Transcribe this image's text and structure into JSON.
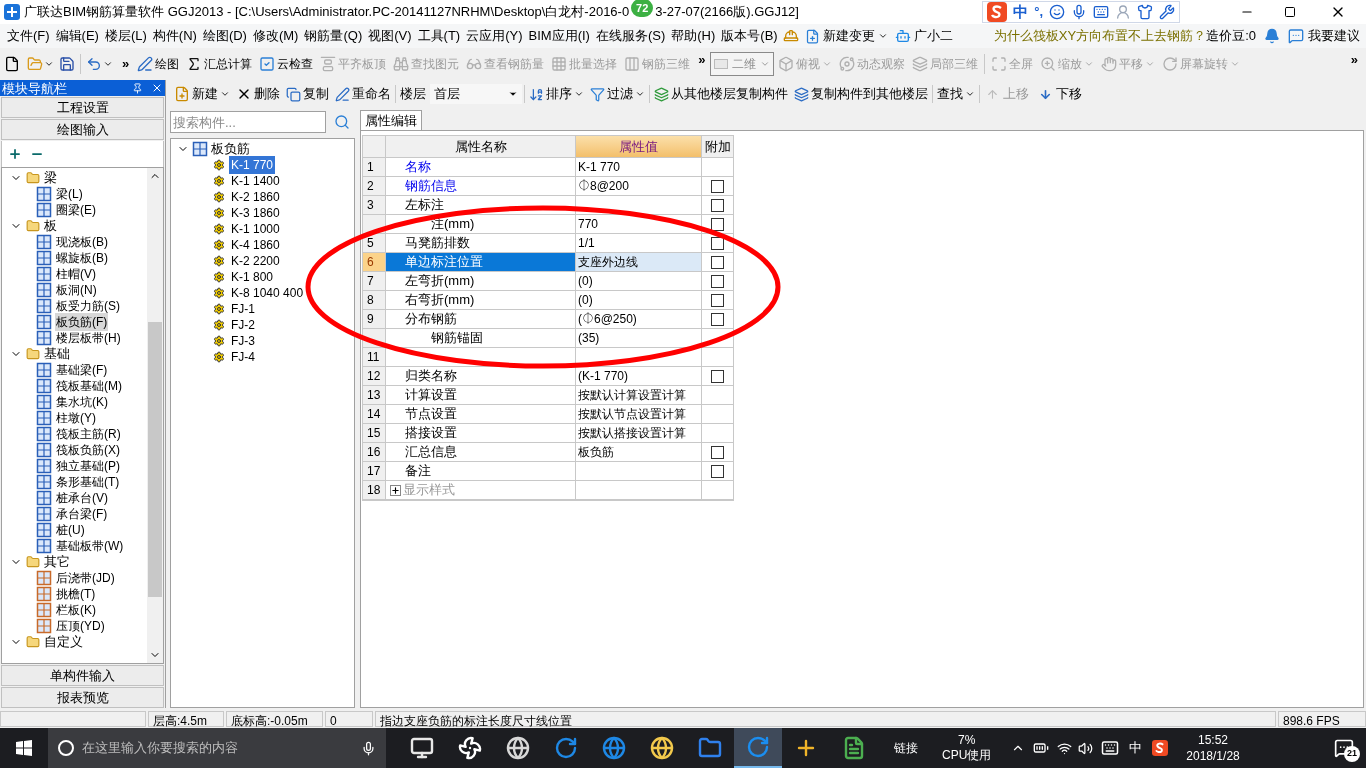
{
  "title_bar": {
    "title": "广联达BIM钢筋算量软件 GGJ2013 - [C:\\Users\\Administrator.PC-20141127NRHM\\Desktop\\白龙村-2016-0",
    "badge": "72",
    "title_end": "3-27-07(2166版).GGJ12]",
    "ime": [
      "中",
      "°,"
    ]
  },
  "menu": {
    "items": [
      "文件(F)",
      "编辑(E)",
      "楼层(L)",
      "构件(N)",
      "绘图(D)",
      "修改(M)",
      "钢筋量(Q)",
      "视图(V)",
      "工具(T)",
      "云应用(Y)",
      "BIM应用(I)",
      "在线服务(S)",
      "帮助(H)",
      "版本号(B)"
    ],
    "extras": [
      {
        "label": "新建变更",
        "menu": true
      },
      {
        "label": "广小二",
        "menu": false
      }
    ],
    "question": "为什么筏板XY方向布置不上去钢筋？",
    "beans": "造价豆:0",
    "suggest": "我要建议"
  },
  "toolbar": {
    "more": "»",
    "groups": [
      [
        {
          "label": "绘图",
          "disabled": false,
          "menu": false
        },
        {
          "label": "汇总计算",
          "disabled": false,
          "menu": false
        },
        {
          "label": "云检查",
          "disabled": false,
          "menu": false
        },
        {
          "label": "平齐板顶",
          "disabled": true,
          "menu": false
        },
        {
          "label": "查找图元",
          "disabled": true,
          "menu": false
        },
        {
          "label": "查看钢筋量",
          "disabled": true,
          "menu": false
        },
        {
          "label": "批量选择",
          "disabled": true,
          "menu": false
        },
        {
          "label": "钢筋三维",
          "disabled": true,
          "menu": false
        }
      ],
      [
        {
          "label": "俯视",
          "disabled": true,
          "menu": true
        },
        {
          "label": "动态观察",
          "disabled": true,
          "menu": false
        },
        {
          "label": "局部三维",
          "disabled": true,
          "menu": false
        }
      ],
      [
        {
          "label": "全屏",
          "disabled": true,
          "menu": false
        },
        {
          "label": "缩放",
          "disabled": true,
          "menu": true
        },
        {
          "label": "平移",
          "disabled": true,
          "menu": true
        },
        {
          "label": "屏幕旋转",
          "disabled": true,
          "menu": true
        }
      ]
    ],
    "view_select": "二维",
    "more_end": "»"
  },
  "nav": {
    "title": "模块导航栏",
    "top_buttons": [
      "工程设置",
      "绘图输入"
    ],
    "groups": [
      {
        "label": "梁",
        "expanded": true,
        "children": [
          {
            "label": "梁(L)",
            "selected": false
          },
          {
            "label": "圈梁(E)",
            "selected": false
          }
        ]
      },
      {
        "label": "板",
        "expanded": true,
        "children": [
          {
            "label": "现浇板(B)",
            "selected": false
          },
          {
            "label": "螺旋板(B)",
            "selected": false
          },
          {
            "label": "柱帽(V)",
            "selected": false
          },
          {
            "label": "板洞(N)",
            "selected": false
          },
          {
            "label": "板受力筋(S)",
            "selected": false
          },
          {
            "label": "板负筋(F)",
            "selected": true
          },
          {
            "label": "楼层板带(H)",
            "selected": false
          }
        ]
      },
      {
        "label": "基础",
        "expanded": true,
        "children": [
          {
            "label": "基础梁(F)",
            "selected": false
          },
          {
            "label": "筏板基础(M)",
            "selected": false
          },
          {
            "label": "集水坑(K)",
            "selected": false
          },
          {
            "label": "柱墩(Y)",
            "selected": false
          },
          {
            "label": "筏板主筋(R)",
            "selected": false
          },
          {
            "label": "筏板负筋(X)",
            "selected": false
          },
          {
            "label": "独立基础(P)",
            "selected": false
          },
          {
            "label": "条形基础(T)",
            "selected": false
          },
          {
            "label": "桩承台(V)",
            "selected": false
          },
          {
            "label": "承台梁(F)",
            "selected": false
          },
          {
            "label": "桩(U)",
            "selected": false
          },
          {
            "label": "基础板带(W)",
            "selected": false
          }
        ]
      },
      {
        "label": "其它",
        "expanded": true,
        "children": [
          {
            "label": "后浇带(JD)",
            "selected": false
          },
          {
            "label": "挑檐(T)",
            "selected": false
          },
          {
            "label": "栏板(K)",
            "selected": false
          },
          {
            "label": "压顶(YD)",
            "selected": false
          }
        ]
      },
      {
        "label": "自定义",
        "expanded": true
      }
    ],
    "bottom_buttons": [
      "单构件输入",
      "报表预览"
    ]
  },
  "component_toolbar": {
    "new": "新建",
    "delete": "删除",
    "copy": "复制",
    "rename": "重命名",
    "floor_label": "楼层",
    "floor": "首层",
    "sort": "排序",
    "filter": "过滤",
    "copy_from": "从其他楼层复制构件",
    "copy_to": "复制构件到其他楼层",
    "find": "查找",
    "up": {
      "label": "上移",
      "disabled": true
    },
    "down": {
      "label": "下移",
      "disabled": false
    }
  },
  "component_tree": {
    "placeholder": "搜索构件...",
    "root": {
      "label": "板负筋",
      "expanded": true,
      "children": [
        {
          "label": "K-1 770",
          "selected": true
        },
        {
          "label": "K-1 1400",
          "selected": false
        },
        {
          "label": "K-2 1860",
          "selected": false
        },
        {
          "label": "K-3 1860",
          "selected": false
        },
        {
          "label": "K-1 1000",
          "selected": false
        },
        {
          "label": "K-4 1860",
          "selected": false
        },
        {
          "label": "K-2 2200",
          "selected": false
        },
        {
          "label": "K-1 800",
          "selected": false
        },
        {
          "label": "K-8 1040 400",
          "selected": false
        },
        {
          "label": "FJ-1",
          "selected": false
        },
        {
          "label": "FJ-2",
          "selected": false
        },
        {
          "label": "FJ-3",
          "selected": false
        },
        {
          "label": "FJ-4",
          "selected": false
        }
      ]
    }
  },
  "property": {
    "tab": "属性编辑",
    "columns": [
      "属性名称",
      "属性值",
      "附加"
    ],
    "rows": [
      {
        "num": "1",
        "name": "名称",
        "value": "K-1 770",
        "kind": "key",
        "selected": false
      },
      {
        "num": "2",
        "name": "钢筋信息",
        "value": "⏀8@200",
        "kind": "key",
        "selected": false,
        "addon": {
          "checked": false
        }
      },
      {
        "num": "3",
        "name": "左标注",
        "kind": "plain",
        "selected": false,
        "addon": {
          "checked": false
        }
      },
      {
        "name": "注(mm)",
        "value": "770",
        "kind": "plain",
        "selected": false,
        "addon": {
          "checked": false
        }
      },
      {
        "num": "5",
        "name": "马凳筋排数",
        "value": "1/1",
        "kind": "plain",
        "selected": false,
        "addon": {
          "checked": false
        }
      },
      {
        "num": "6",
        "name": "单边标注位置",
        "value": "支座外边线",
        "kind": "plain",
        "selected": true,
        "addon": {
          "checked": false
        }
      },
      {
        "num": "7",
        "name": "左弯折(mm)",
        "value": "(0)",
        "kind": "plain",
        "selected": false,
        "addon": {
          "checked": false
        }
      },
      {
        "num": "8",
        "name": "右弯折(mm)",
        "value": "(0)",
        "kind": "plain",
        "selected": false,
        "addon": {
          "checked": false
        }
      },
      {
        "num": "9",
        "name": "分布钢筋",
        "value": "(⏀6@250)",
        "kind": "plain",
        "selected": false,
        "addon": {
          "checked": false
        }
      },
      {
        "name": "钢筋锚固",
        "value": "(35)",
        "kind": "plain",
        "selected": false
      },
      {
        "num": "11",
        "kind": "plain",
        "selected": false
      },
      {
        "num": "12",
        "name": "归类名称",
        "value": "(K-1 770)",
        "kind": "plain",
        "selected": false,
        "addon": {
          "checked": false
        }
      },
      {
        "num": "13",
        "name": "计算设置",
        "value": "按默认计算设置计算",
        "kind": "plain",
        "selected": false
      },
      {
        "num": "14",
        "name": "节点设置",
        "value": "按默认节点设置计算",
        "kind": "plain",
        "selected": false
      },
      {
        "num": "15",
        "name": "搭接设置",
        "value": "按默认搭接设置计算",
        "kind": "plain",
        "selected": false
      },
      {
        "num": "16",
        "name": "汇总信息",
        "value": "板负筋",
        "kind": "plain",
        "selected": false,
        "addon": {
          "checked": false
        }
      },
      {
        "num": "17",
        "name": "备注",
        "kind": "plain",
        "selected": false,
        "addon": {
          "checked": false
        }
      },
      {
        "num": "18",
        "name": "显示样式",
        "kind": "group",
        "selected": false
      }
    ]
  },
  "status_bar": [
    "层高:4.5m",
    "底标高:-0.05m",
    "0",
    "指边支座负筋的标注长度尺寸线位置",
    "898.6 FPS"
  ],
  "taskbar": {
    "search": {
      "placeholder": "在这里输入你要搜索的内容"
    },
    "apps": [
      {
        "selected": false
      },
      {
        "selected": false
      },
      {
        "selected": false
      },
      {
        "selected": false
      },
      {
        "selected": false
      },
      {
        "selected": false
      },
      {
        "selected": false
      },
      {
        "selected": true
      },
      {
        "selected": false
      },
      {
        "selected": false
      }
    ],
    "link": "链接",
    "cpu": "7%",
    "cpu_label": "CPU使用",
    "ime": "中",
    "time": "15:52",
    "date": "2018/1/28",
    "notifications": "21"
  }
}
